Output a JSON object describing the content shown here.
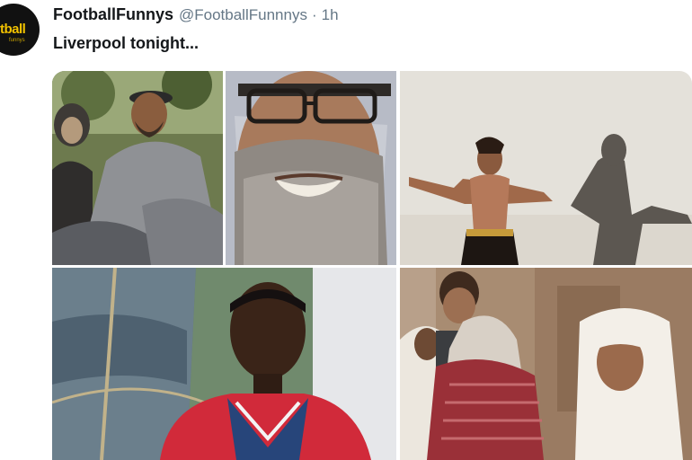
{
  "tweet": {
    "author_name": "FootballFunnys",
    "handle": "@FootballFunnnys",
    "separator": "·",
    "time": "1h",
    "text": "Liverpool tonight...",
    "avatar_logo_text": "tball",
    "avatar_logo_subtext": "funnys"
  },
  "media": {
    "photo_count": 5,
    "accent_colors": {
      "text_primary": "#14171a",
      "text_secondary": "#657786",
      "avatar_bg": "#111111",
      "avatar_logo": "#f2c200"
    }
  }
}
